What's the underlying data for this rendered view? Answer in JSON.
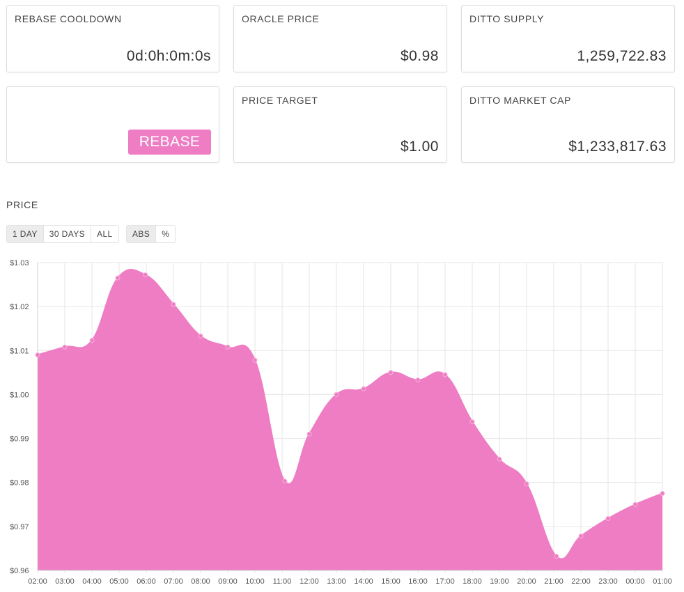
{
  "cards": {
    "rebase_cooldown": {
      "label": "REBASE COOLDOWN",
      "value": "0d:0h:0m:0s"
    },
    "oracle_price": {
      "label": "ORACLE PRICE",
      "value": "$0.98"
    },
    "ditto_supply": {
      "label": "DITTO SUPPLY",
      "value": "1,259,722.83"
    },
    "rebase_button": {
      "label": "REBASE"
    },
    "price_target": {
      "label": "PRICE TARGET",
      "value": "$1.00"
    },
    "market_cap": {
      "label": "DITTO MARKET CAP",
      "value": "$1,233,817.63"
    }
  },
  "price_section": {
    "title": "PRICE",
    "range_buttons": [
      {
        "label": "1 DAY",
        "active": true
      },
      {
        "label": "30 DAYS",
        "active": false
      },
      {
        "label": "ALL",
        "active": false
      }
    ],
    "mode_buttons": [
      {
        "label": "ABS",
        "active": true
      },
      {
        "label": "%",
        "active": false
      }
    ]
  },
  "colors": {
    "accent": "#ee7dc3",
    "grid": "#e6e6e6"
  },
  "chart_data": {
    "type": "area",
    "title": "",
    "xlabel": "",
    "ylabel": "",
    "ylim": [
      0.96,
      1.03
    ],
    "y_ticks": [
      1.03,
      1.02,
      1.01,
      1.0,
      0.99,
      0.98,
      0.97,
      0.96
    ],
    "y_tick_labels": [
      "$1.03",
      "$1.02",
      "$1.01",
      "$1.00",
      "$0.99",
      "$0.98",
      "$0.97",
      "$0.96"
    ],
    "x_tick_labels": [
      "02:00",
      "03:00",
      "04:00",
      "05:00",
      "06:00",
      "07:00",
      "08:00",
      "09:00",
      "10:00",
      "11:00",
      "12:00",
      "13:00",
      "14:00",
      "15:00",
      "16:00",
      "17:00",
      "18:00",
      "19:00",
      "20:00",
      "21:00",
      "22:00",
      "23:00",
      "00:00",
      "01:00"
    ],
    "grid": true,
    "series": [
      {
        "points": [
          {
            "x": 0.0,
            "y": 1.009
          },
          {
            "x": 1.0,
            "y": 1.0108
          },
          {
            "x": 2.0,
            "y": 1.0123
          },
          {
            "x": 2.95,
            "y": 1.0265
          },
          {
            "x": 3.97,
            "y": 1.0272
          },
          {
            "x": 5.0,
            "y": 1.0205
          },
          {
            "x": 6.0,
            "y": 1.0133
          },
          {
            "x": 7.0,
            "y": 1.0108
          },
          {
            "x": 8.0,
            "y": 1.0078
          },
          {
            "x": 9.1,
            "y": 0.9803
          },
          {
            "x": 10.0,
            "y": 0.991
          },
          {
            "x": 11.0,
            "y": 1.0
          },
          {
            "x": 12.0,
            "y": 1.0013
          },
          {
            "x": 13.0,
            "y": 1.005
          },
          {
            "x": 14.0,
            "y": 1.0033
          },
          {
            "x": 15.0,
            "y": 1.0045
          },
          {
            "x": 16.0,
            "y": 0.9938
          },
          {
            "x": 17.0,
            "y": 0.9853
          },
          {
            "x": 18.0,
            "y": 0.9797
          },
          {
            "x": 19.1,
            "y": 0.9632
          },
          {
            "x": 20.0,
            "y": 0.9678
          },
          {
            "x": 21.0,
            "y": 0.9718
          },
          {
            "x": 22.0,
            "y": 0.975
          },
          {
            "x": 23.0,
            "y": 0.9775
          }
        ]
      }
    ]
  }
}
